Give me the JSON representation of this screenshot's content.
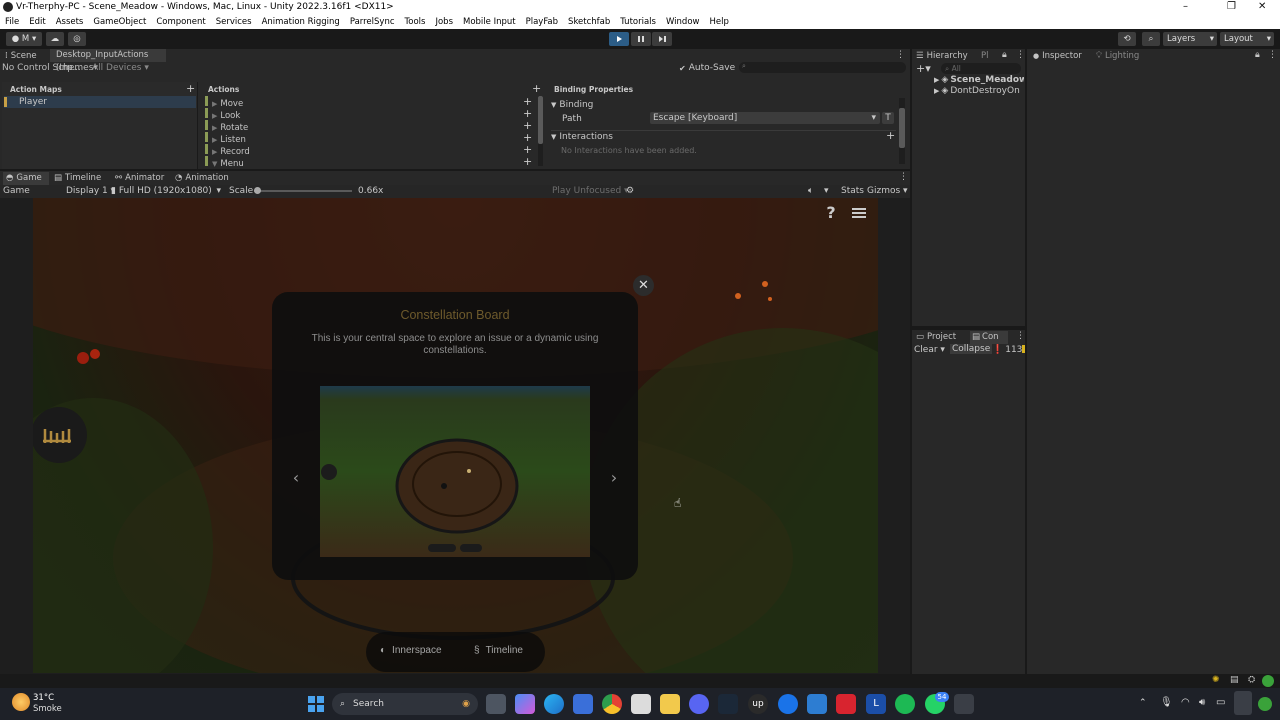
{
  "window": {
    "title": "Vr-Therphy-PC - Scene_Meadow - Windows, Mac, Linux - Unity 2022.3.16f1 <DX11>"
  },
  "menu": [
    "File",
    "Edit",
    "Assets",
    "GameObject",
    "Component",
    "Services",
    "Animation Rigging",
    "ParrelSync",
    "Tools",
    "Jobs",
    "Mobile Input",
    "PlayFab",
    "Sketchfab",
    "Tutorials",
    "Window",
    "Help"
  ],
  "toolbar": {
    "account": "M",
    "layers": "Layers",
    "layout": "Layout"
  },
  "input_actions": {
    "tabs": [
      "Scene",
      "Desktop_InputActions (Inp..."
    ],
    "control_scheme": "No Control Schemes",
    "devices": "All Devices",
    "auto_save": "Auto-Save",
    "action_maps_header": "Action Maps",
    "action_maps": [
      "Player"
    ],
    "actions_header": "Actions",
    "actions": [
      "Move",
      "Look",
      "Rotate",
      "Listen",
      "Record",
      "Menu"
    ],
    "binding_header": "Binding Properties",
    "binding_label": "Binding",
    "path_label": "Path",
    "path_value": "Escape [Keyboard]",
    "path_t": "T",
    "interactions_label": "Interactions",
    "no_interactions": "No Interactions have been added."
  },
  "game_tabs": [
    "Game",
    "Timeline",
    "Animator",
    "Animation"
  ],
  "game_bar": {
    "mode": "Game",
    "display": "Display 1",
    "resolution": "Full HD (1920x1080)",
    "scale_label": "Scale",
    "scale_value": "0.66x",
    "play_mode": "Play Unfocused",
    "stats": "Stats",
    "gizmos": "Gizmos"
  },
  "game_view": {
    "help": "?",
    "modal_title": "Constellation Board",
    "modal_body": "This is your central space to explore an issue or a dynamic using constellations.",
    "dock": [
      "Innerspace",
      "Timeline"
    ]
  },
  "hierarchy": {
    "tabs": [
      "Hierarchy",
      "Pl"
    ],
    "search": "All",
    "items": [
      "Scene_Meadow",
      "DontDestroyOn"
    ]
  },
  "project": {
    "tabs": [
      "Project",
      "Con"
    ],
    "clear": "Clear",
    "collapse": "Collapse",
    "count": "113"
  },
  "inspector": {
    "tabs": [
      "Inspector",
      "Lighting"
    ]
  },
  "taskbar": {
    "temp": "31°C",
    "weather": "Smoke",
    "search": "Search",
    "notif": "54"
  },
  "colors": {
    "accent": "#2c5d87",
    "bg": "#191919",
    "panel": "#282828"
  }
}
